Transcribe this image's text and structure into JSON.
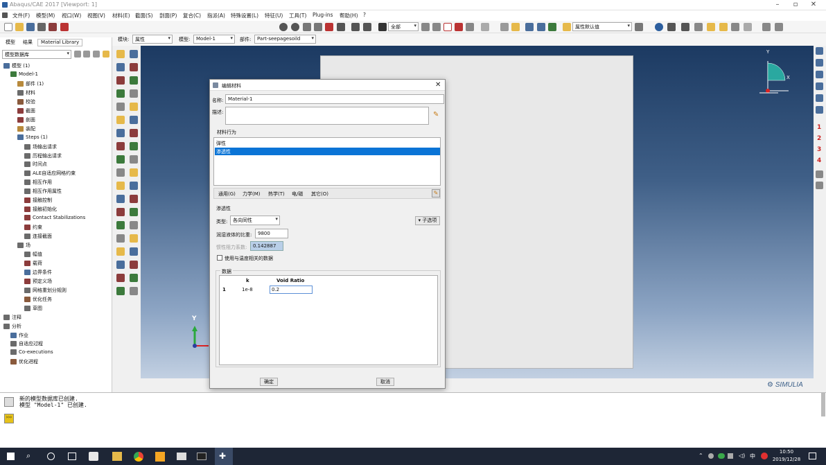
{
  "window": {
    "title": "Abaqus/CAE 2017 [Viewport: 1]"
  },
  "menubar": [
    "文件(F)",
    "模型(M)",
    "视口(W)",
    "视图(V)",
    "材料(E)",
    "截面(S)",
    "剖面(P)",
    "复合(C)",
    "指派(A)",
    "特殊设置(L)",
    "特征(U)",
    "工具(T)",
    "Plug-ins",
    "帮助(H)",
    "?"
  ],
  "toolbar": {
    "select_label": "全部",
    "render_label": "属性默认值"
  },
  "context": {
    "module_label": "模块:",
    "module_value": "属性",
    "model_label": "模型:",
    "model_value": "Model-1",
    "part_label": "部件:",
    "part_value": "Part-seepagesoild"
  },
  "left_panel": {
    "tabs": [
      "模型",
      "结果",
      "Material Library"
    ],
    "filter_value": "模型数据库",
    "tree": [
      {
        "label": "模型 (1)",
        "indent": 0,
        "color": "#4a6e9c"
      },
      {
        "label": "Model-1",
        "indent": 1,
        "color": "#3c7a3c"
      },
      {
        "label": "部件 (1)",
        "indent": 2,
        "color": "#b88a3c"
      },
      {
        "label": "材料",
        "indent": 2,
        "color": "#6b6b6b"
      },
      {
        "label": "校验",
        "indent": 2,
        "color": "#8a5a3c"
      },
      {
        "label": "截面",
        "indent": 2,
        "color": "#8c3c3c"
      },
      {
        "label": "剖面",
        "indent": 2,
        "color": "#8c3c3c"
      },
      {
        "label": "装配",
        "indent": 2,
        "color": "#b88a3c"
      },
      {
        "label": "Steps (1)",
        "indent": 2,
        "color": "#4a6e9c"
      },
      {
        "label": "场输出请求",
        "indent": 3,
        "color": "#6b6b6b"
      },
      {
        "label": "历程输出请求",
        "indent": 3,
        "color": "#6b6b6b"
      },
      {
        "label": "时间点",
        "indent": 3,
        "color": "#6b6b6b"
      },
      {
        "label": "ALE自适应网格约束",
        "indent": 3,
        "color": "#6b6b6b"
      },
      {
        "label": "相互作用",
        "indent": 3,
        "color": "#6b6b6b"
      },
      {
        "label": "相互作用属性",
        "indent": 3,
        "color": "#6b6b6b"
      },
      {
        "label": "接触控制",
        "indent": 3,
        "color": "#8c3c3c"
      },
      {
        "label": "接触初始化",
        "indent": 3,
        "color": "#8c3c3c"
      },
      {
        "label": "Contact Stabilizations",
        "indent": 3,
        "color": "#8c3c3c"
      },
      {
        "label": "约束",
        "indent": 3,
        "color": "#8c3c3c"
      },
      {
        "label": "连接截面",
        "indent": 3,
        "color": "#6b6b6b"
      },
      {
        "label": "场",
        "indent": 2,
        "color": "#6b6b6b"
      },
      {
        "label": "幅值",
        "indent": 3,
        "color": "#6b6b6b"
      },
      {
        "label": "载荷",
        "indent": 3,
        "color": "#8c3c3c"
      },
      {
        "label": "边界条件",
        "indent": 3,
        "color": "#4a6e9c"
      },
      {
        "label": "预定义场",
        "indent": 3,
        "color": "#8c3c3c"
      },
      {
        "label": "网格重划分规则",
        "indent": 3,
        "color": "#6b6b6b"
      },
      {
        "label": "优化任务",
        "indent": 3,
        "color": "#8a5a3c"
      },
      {
        "label": "草图",
        "indent": 3,
        "color": "#6b6b6b"
      },
      {
        "label": "注释",
        "indent": 0,
        "color": "#6b6b6b"
      },
      {
        "label": "分析",
        "indent": 0,
        "color": "#6b6b6b"
      },
      {
        "label": "作业",
        "indent": 1,
        "color": "#4a6e9c"
      },
      {
        "label": "自适应过程",
        "indent": 1,
        "color": "#6b6b6b"
      },
      {
        "label": "Co-executions",
        "indent": 1,
        "color": "#6b6b6b"
      },
      {
        "label": "优化进程",
        "indent": 1,
        "color": "#8a5a3c"
      }
    ]
  },
  "viewport": {
    "axis_y": "Y",
    "axis_x": "X",
    "triad_y": "Y",
    "brand": "SIMULIA"
  },
  "right_tools": [
    "1",
    "2",
    "3",
    "4"
  ],
  "dialog": {
    "title": "编辑材料",
    "name_label": "名称:",
    "name_value": "Material-1",
    "desc_label": "描述:",
    "desc_value": "",
    "behaviors_label": "材料行为",
    "behaviors": [
      "弹性",
      "渗透性"
    ],
    "selected_behavior": 1,
    "menus": [
      "通用(G)",
      "力学(M)",
      "热学(T)",
      "电/磁",
      "其它(O)"
    ],
    "section_title": "渗透性",
    "type_label": "类型:",
    "type_value": "各向同性",
    "suboptions_label": "子选项",
    "weight_label": "润湿液体的比重:",
    "weight_value": "9800",
    "inertial_label": "惯性阻力系数:",
    "inertial_value": "0.142887",
    "temp_checkbox_label": "使用与温度相关的数据",
    "data_label": "数据",
    "table": {
      "headers": [
        "k",
        "Void Ratio"
      ],
      "rows": [
        {
          "index": "1",
          "k": "1e-8",
          "void": "0.2"
        }
      ]
    },
    "ok_label": "确定",
    "cancel_label": "取消"
  },
  "messages": [
    "新的模型数据库已创建.",
    "模型 \"Model-1\" 已创建."
  ],
  "taskbar": {
    "time": "10:50",
    "date": "2019/12/28",
    "lang": "中"
  }
}
